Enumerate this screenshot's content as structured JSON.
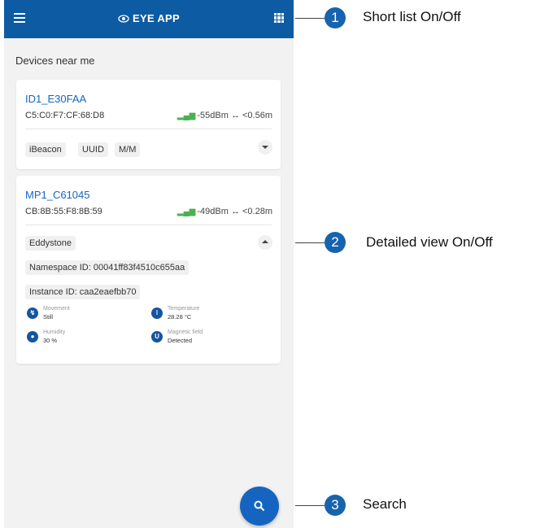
{
  "app": {
    "title": "EYE APP",
    "brand_color": "#0d5ba3",
    "menu_icon": "hamburger-icon",
    "list_toggle_icon": "grid-icon"
  },
  "main": {
    "section_title": "Devices near me"
  },
  "devices": [
    {
      "name": "ID1_E30FAA",
      "mac": "C5:C0:F7:CF:68:D8",
      "signal": "-55dBm ↔ <0.56m",
      "chips": [
        "iBeacon",
        "UUID",
        "M/M"
      ],
      "expanded": false
    },
    {
      "name": "MP1_C61045",
      "mac": "CB:8B:55:F8:8B:59",
      "signal": "-49dBm ↔ <0.28m",
      "protocol": "Eddystone",
      "namespace": "Namespace ID: 00041ff83f4510c655aa",
      "instance": "Instance ID: caa2eaefbb70",
      "expanded": true,
      "sensors": [
        {
          "label": "Movement",
          "value": "Still",
          "icon": "movement-icon"
        },
        {
          "label": "Temperature",
          "value": "28.28 °C",
          "icon": "thermometer-icon"
        },
        {
          "label": "Humidity",
          "value": "30 %",
          "icon": "droplet-icon"
        },
        {
          "label": "Magnetic field",
          "value": "Detected",
          "icon": "magnet-icon"
        }
      ]
    }
  ],
  "search_icon": "search-icon",
  "callouts": [
    {
      "number": "1",
      "text": "Short list On/Off"
    },
    {
      "number": "2",
      "text": "Detailed view On/Off"
    },
    {
      "number": "3",
      "text": "Search"
    }
  ]
}
